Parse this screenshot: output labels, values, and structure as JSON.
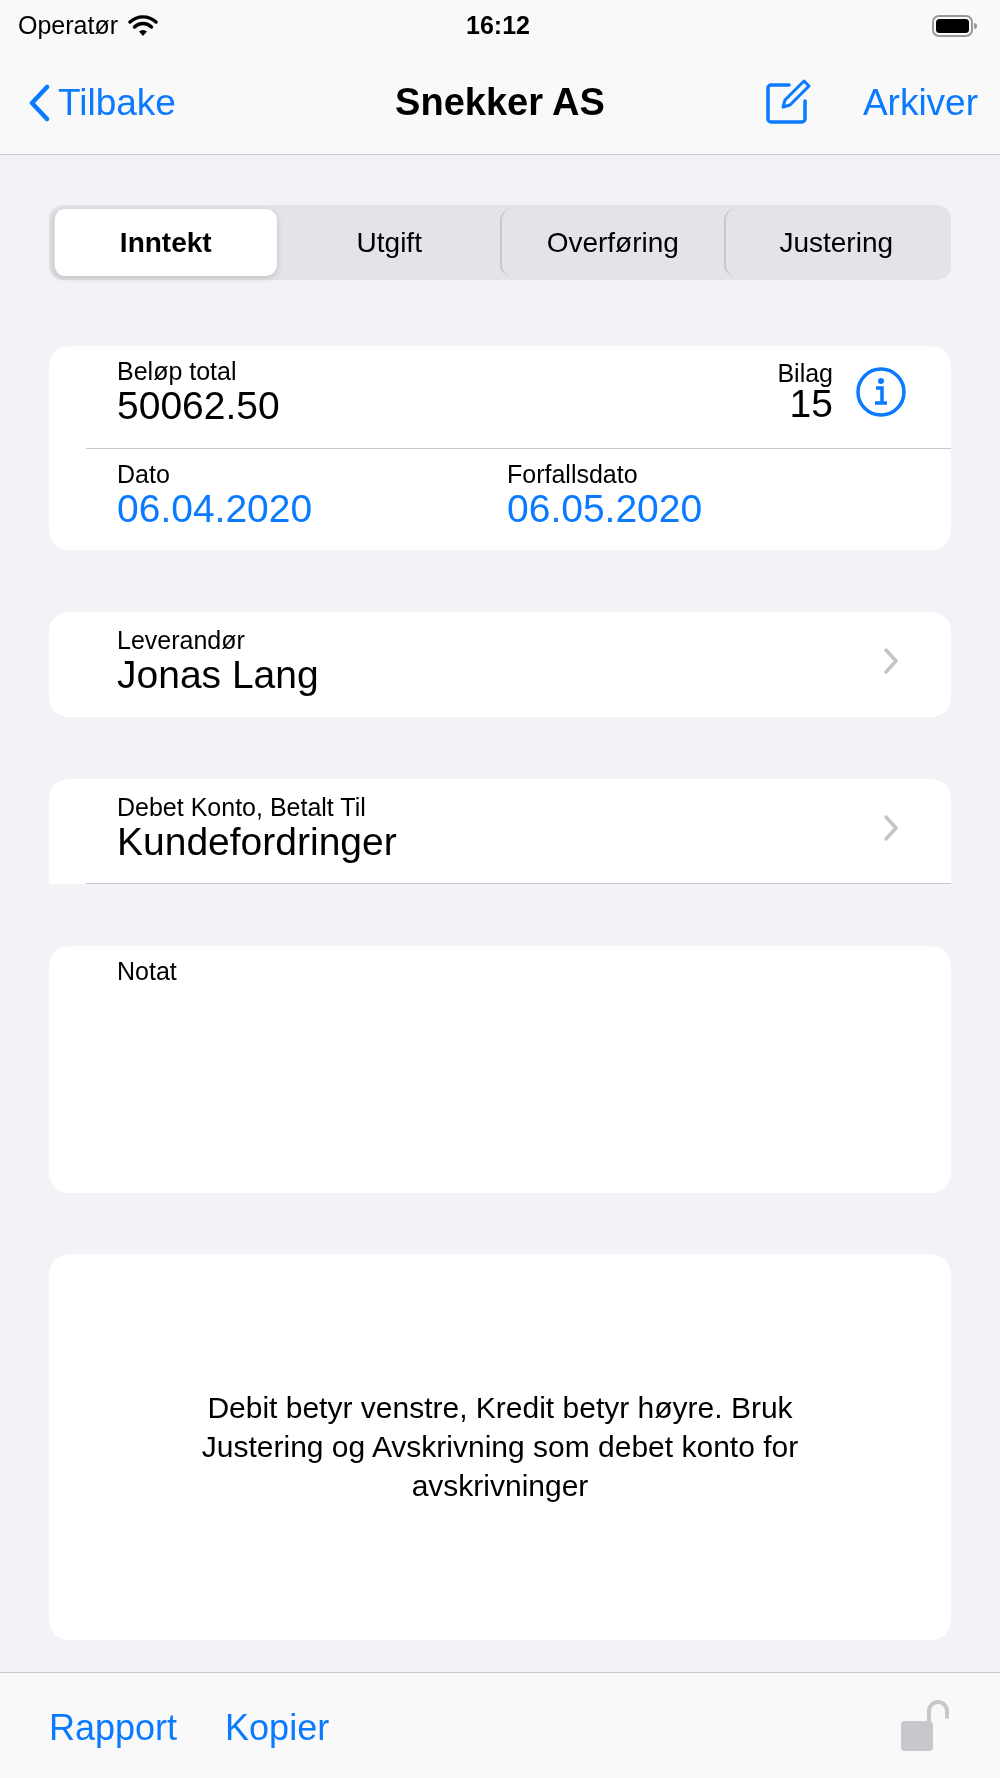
{
  "status_bar": {
    "carrier": "Operatør",
    "time": "16:12"
  },
  "nav": {
    "back": "Tilbake",
    "title": "Snekker AS",
    "action": "Arkiver"
  },
  "segments": [
    {
      "label": "Inntekt",
      "selected": true
    },
    {
      "label": "Utgift",
      "selected": false
    },
    {
      "label": "Overføring",
      "selected": false
    },
    {
      "label": "Justering",
      "selected": false
    }
  ],
  "amount_card": {
    "amount_label": "Beløp total",
    "amount": "50062.50",
    "voucher_label": "Bilag",
    "voucher": "15",
    "date_label": "Dato",
    "date": "06.04.2020",
    "due_label": "Forfallsdato",
    "due": "06.05.2020"
  },
  "rows": [
    {
      "label": "Leverandør",
      "value": "Jonas Lang"
    },
    {
      "label": "Debet Konto, Betalt Til",
      "value": "Kundefordringer"
    }
  ],
  "note": {
    "label": "Notat"
  },
  "hint": "Debit betyr venstre, Kredit betyr høyre. Bruk Justering og Avskrivning som debet konto for avskrivninger",
  "toolbar": [
    "Rapport",
    "Kopier"
  ]
}
